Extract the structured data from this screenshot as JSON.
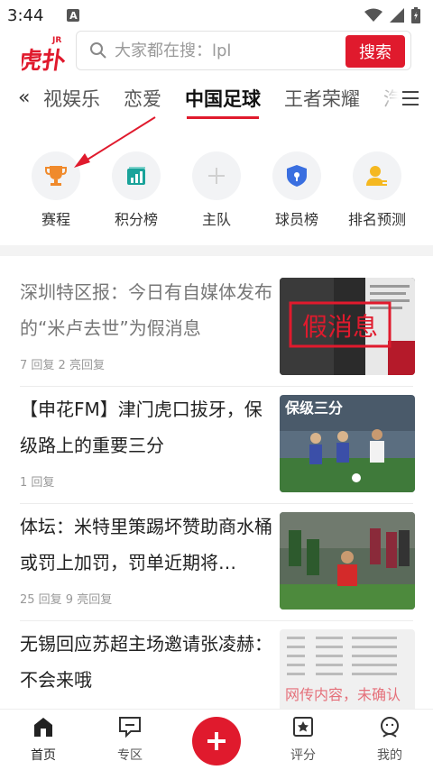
{
  "status_bar": {
    "time": "3:44",
    "notification_letter": "A"
  },
  "logo": {
    "text": "虎扑",
    "superscript": "JR"
  },
  "search": {
    "placeholder": "大家都在搜：lpl",
    "button_label": "搜索"
  },
  "tabs": {
    "items": [
      "视娱乐",
      "恋爱",
      "中国足球",
      "王者荣耀",
      "汽"
    ],
    "active": "中国足球"
  },
  "quick_entries": [
    {
      "label": "赛程",
      "icon": "trophy-icon"
    },
    {
      "label": "积分榜",
      "icon": "bar-chart-icon"
    },
    {
      "label": "主队",
      "icon": "plus-icon"
    },
    {
      "label": "球员榜",
      "icon": "shield-icon"
    },
    {
      "label": "排名预测",
      "icon": "person-icon"
    }
  ],
  "news": [
    {
      "title": "深圳特区报：今日有自媒体发布的“米卢去世”为假消息",
      "meta": "7 回复 2 亮回复",
      "thumb_text": "假消息",
      "read": true
    },
    {
      "title": "【申花FM】津门虎口拔牙，保级路上的重要三分",
      "meta": "1 回复",
      "thumb_text": "保级三分",
      "read": false
    },
    {
      "title": "体坛：米特里策踢坏赞助商水桶或罚上加罚，罚单近期将…",
      "meta": "25 回复 9 亮回复",
      "thumb_text": "",
      "read": false
    },
    {
      "title": "无锡回应苏超主场邀请张凌赫：不会来哦",
      "meta": "",
      "thumb_text": "网传内容，未确认",
      "read": false
    }
  ],
  "bottom_nav": {
    "items": [
      {
        "label": "首页",
        "icon": "home-icon",
        "active": true
      },
      {
        "label": "专区",
        "icon": "chat-icon",
        "active": false
      },
      {
        "label": "评分",
        "icon": "star-rating-icon",
        "active": false
      },
      {
        "label": "我的",
        "icon": "profile-icon",
        "active": false
      }
    ]
  },
  "colors": {
    "brand_red": "#e01a2d"
  }
}
